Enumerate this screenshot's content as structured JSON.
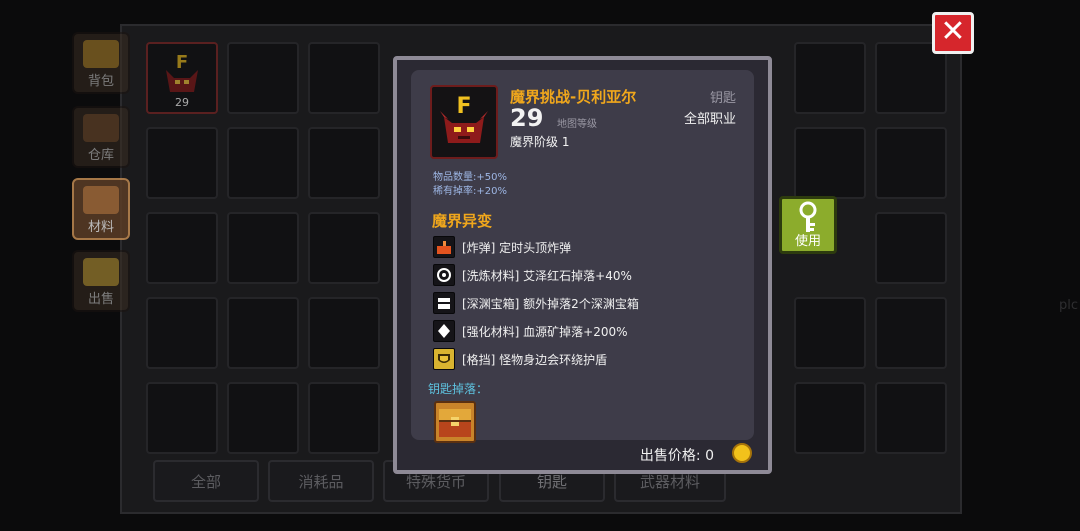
{
  "sidebar": {
    "tabs": [
      {
        "label": "背包"
      },
      {
        "label": "仓库"
      },
      {
        "label": "材料"
      },
      {
        "label": "出售"
      }
    ]
  },
  "inventory": {
    "key_slot_count": "29"
  },
  "filter_tabs": [
    {
      "label": "全部"
    },
    {
      "label": "消耗品"
    },
    {
      "label": "特殊货币"
    },
    {
      "label": "钥匙"
    },
    {
      "label": "武器材料"
    }
  ],
  "close_button": {
    "label": "✕"
  },
  "use_button": {
    "label": "使用"
  },
  "item": {
    "icon_letter": "F",
    "name": "魔界挑战-贝利亚尔",
    "level": "29",
    "level_label": "地图等级",
    "tier": "魔界阶级 1",
    "type": "钥匙",
    "class": "全部职业",
    "stats": [
      "物品数量:+50%",
      "稀有掉率:+20%"
    ],
    "mutation_title": "魔界异变",
    "mutations": [
      {
        "text": "[炸弹] 定时头顶炸弹",
        "icon": "bomb-icon",
        "color": "#e2531f"
      },
      {
        "text": "[洗炼材料] 艾泽红石掉落+40%",
        "icon": "gear-icon",
        "color": "#ffffff"
      },
      {
        "text": "[深渊宝箱] 额外掉落2个深渊宝箱",
        "icon": "chest-icon",
        "color": "#ffffff"
      },
      {
        "text": "[强化材料] 血源矿掉落+200%",
        "icon": "diamond-icon",
        "color": "#ffffff"
      },
      {
        "text": "[格挡] 怪物身边会环绕护盾",
        "icon": "shield-icon",
        "color": "#e8c23a"
      }
    ],
    "drop_title": "钥匙掉落：",
    "price_label": "出售价格: 0"
  },
  "background_text": "plc",
  "colors": {
    "accent_orange": "#f0a71c",
    "close_red": "#d6262c",
    "use_green": "#8cac2c",
    "drop_blue": "#5ec3e0"
  }
}
